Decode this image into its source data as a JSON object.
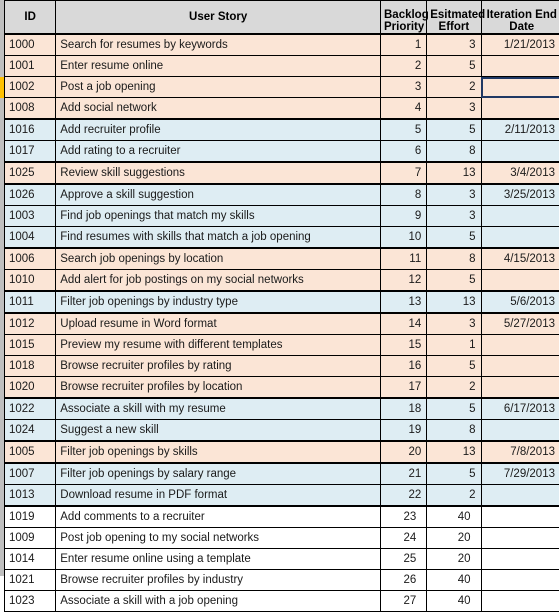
{
  "table": {
    "columns": [
      {
        "key": "id",
        "label": "ID"
      },
      {
        "key": "story",
        "label": "User Story"
      },
      {
        "key": "prio",
        "label": "Backlog Priority"
      },
      {
        "key": "effort",
        "label": "Esitmated Effort"
      },
      {
        "key": "date",
        "label": "Iteration End Date"
      }
    ],
    "header_labels": {
      "id": "ID",
      "story": "User Story",
      "prio_line1": "Backlog",
      "prio_line2": "Priority",
      "effort_line1": "Esitmated",
      "effort_line2": "Effort",
      "date_line1": "Iteration End",
      "date_line2": "Date"
    },
    "colors": {
      "header_fill": "#D9D9D9",
      "band_peach": "#FBE5D6",
      "band_blue": "#DEEDF3",
      "band_white": "#FFFFFF",
      "gridline": "#000000",
      "selection_border": "#1F3864",
      "row_marker": "#FFC000"
    },
    "selection": {
      "row_id": "1002",
      "column": "date",
      "row_index": 2
    },
    "rows": [
      {
        "id": "1000",
        "story": "Search for resumes by keywords",
        "prio": "1",
        "effort": "3",
        "date": "1/21/2013",
        "band": "peach",
        "group_start": true,
        "group_end": false
      },
      {
        "id": "1001",
        "story": "Enter resume online",
        "prio": "2",
        "effort": "5",
        "date": "",
        "band": "peach",
        "group_start": false,
        "group_end": false
      },
      {
        "id": "1002",
        "story": "Post a job opening",
        "prio": "3",
        "effort": "2",
        "date": "",
        "band": "peach",
        "group_start": false,
        "group_end": false
      },
      {
        "id": "1008",
        "story": "Add social network",
        "prio": "4",
        "effort": "3",
        "date": "",
        "band": "peach",
        "group_start": false,
        "group_end": true
      },
      {
        "id": "1016",
        "story": "Add recruiter profile",
        "prio": "5",
        "effort": "5",
        "date": "2/11/2013",
        "band": "blue",
        "group_start": true,
        "group_end": false
      },
      {
        "id": "1017",
        "story": "Add rating to a recruiter",
        "prio": "6",
        "effort": "8",
        "date": "",
        "band": "blue",
        "group_start": false,
        "group_end": true
      },
      {
        "id": "1025",
        "story": "Review skill suggestions",
        "prio": "7",
        "effort": "13",
        "date": "3/4/2013",
        "band": "peach",
        "group_start": true,
        "group_end": true
      },
      {
        "id": "1026",
        "story": "Approve a skill suggestion",
        "prio": "8",
        "effort": "3",
        "date": "3/25/2013",
        "band": "blue",
        "group_start": true,
        "group_end": false
      },
      {
        "id": "1003",
        "story": "Find job openings that match my skills",
        "prio": "9",
        "effort": "3",
        "date": "",
        "band": "blue",
        "group_start": false,
        "group_end": false
      },
      {
        "id": "1004",
        "story": "Find resumes with skills that match a job opening",
        "prio": "10",
        "effort": "5",
        "date": "",
        "band": "blue",
        "group_start": false,
        "group_end": true
      },
      {
        "id": "1006",
        "story": "Search job openings by location",
        "prio": "11",
        "effort": "8",
        "date": "4/15/2013",
        "band": "peach",
        "group_start": true,
        "group_end": false
      },
      {
        "id": "1010",
        "story": "Add alert for job postings on my social networks",
        "prio": "12",
        "effort": "5",
        "date": "",
        "band": "peach",
        "group_start": false,
        "group_end": true
      },
      {
        "id": "1011",
        "story": "Filter job openings by industry type",
        "prio": "13",
        "effort": "13",
        "date": "5/6/2013",
        "band": "blue",
        "group_start": true,
        "group_end": true
      },
      {
        "id": "1012",
        "story": "Upload resume in Word format",
        "prio": "14",
        "effort": "3",
        "date": "5/27/2013",
        "band": "peach",
        "group_start": true,
        "group_end": false
      },
      {
        "id": "1015",
        "story": "Preview my resume with different templates",
        "prio": "15",
        "effort": "1",
        "date": "",
        "band": "peach",
        "group_start": false,
        "group_end": false
      },
      {
        "id": "1018",
        "story": "Browse recruiter profiles by rating",
        "prio": "16",
        "effort": "5",
        "date": "",
        "band": "peach",
        "group_start": false,
        "group_end": false
      },
      {
        "id": "1020",
        "story": "Browse recruiter profiles by location",
        "prio": "17",
        "effort": "2",
        "date": "",
        "band": "peach",
        "group_start": false,
        "group_end": true
      },
      {
        "id": "1022",
        "story": "Associate a skill with my resume",
        "prio": "18",
        "effort": "5",
        "date": "6/17/2013",
        "band": "blue",
        "group_start": true,
        "group_end": false
      },
      {
        "id": "1024",
        "story": "Suggest a new skill",
        "prio": "19",
        "effort": "8",
        "date": "",
        "band": "blue",
        "group_start": false,
        "group_end": true
      },
      {
        "id": "1005",
        "story": "Filter job openings by skills",
        "prio": "20",
        "effort": "13",
        "date": "7/8/2013",
        "band": "peach",
        "group_start": true,
        "group_end": true
      },
      {
        "id": "1007",
        "story": "Filter job openings by salary range",
        "prio": "21",
        "effort": "5",
        "date": "7/29/2013",
        "band": "blue",
        "group_start": true,
        "group_end": false
      },
      {
        "id": "1013",
        "story": "Download resume in PDF format",
        "prio": "22",
        "effort": "2",
        "date": "",
        "band": "blue",
        "group_start": false,
        "group_end": true
      },
      {
        "id": "1019",
        "story": "Add comments to a recruiter",
        "prio": "23",
        "effort": "40",
        "date": "",
        "band": "white",
        "group_start": true,
        "group_end": false
      },
      {
        "id": "1009",
        "story": "Post job opening to my social networks",
        "prio": "24",
        "effort": "20",
        "date": "",
        "band": "white",
        "group_start": false,
        "group_end": false
      },
      {
        "id": "1014",
        "story": "Enter resume online using a template",
        "prio": "25",
        "effort": "20",
        "date": "",
        "band": "white",
        "group_start": false,
        "group_end": false
      },
      {
        "id": "1021",
        "story": "Browse recruiter profiles by industry",
        "prio": "26",
        "effort": "40",
        "date": "",
        "band": "white",
        "group_start": false,
        "group_end": false
      },
      {
        "id": "1023",
        "story": "Associate a skill with a job opening",
        "prio": "27",
        "effort": "40",
        "date": "",
        "band": "white",
        "group_start": false,
        "group_end": false
      }
    ]
  }
}
